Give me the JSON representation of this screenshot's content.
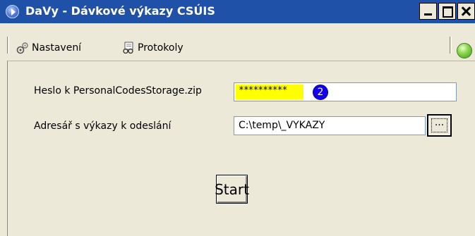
{
  "window": {
    "title": "DaVy - Dávkové výkazy CSÚIS"
  },
  "toolbar": {
    "settings_label": "Nastavení",
    "protocols_label": "Protokoly",
    "status_color": "#6cc23a"
  },
  "form": {
    "password_label": "Heslo k PersonalCodesStorage.zip",
    "password_value": "**********",
    "password_highlight_color": "#ffff00",
    "badge_number": "2",
    "directory_label": "Adresář s výkazy k odeslání",
    "directory_value": "C:\\temp\\_VYKAZY",
    "browse_label": "...",
    "start_label": "Start"
  },
  "icons": {
    "app": "arrow-right-circle-icon",
    "settings": "gears-icon",
    "protocols": "document-glasses-icon",
    "status": "green-led-icon"
  }
}
